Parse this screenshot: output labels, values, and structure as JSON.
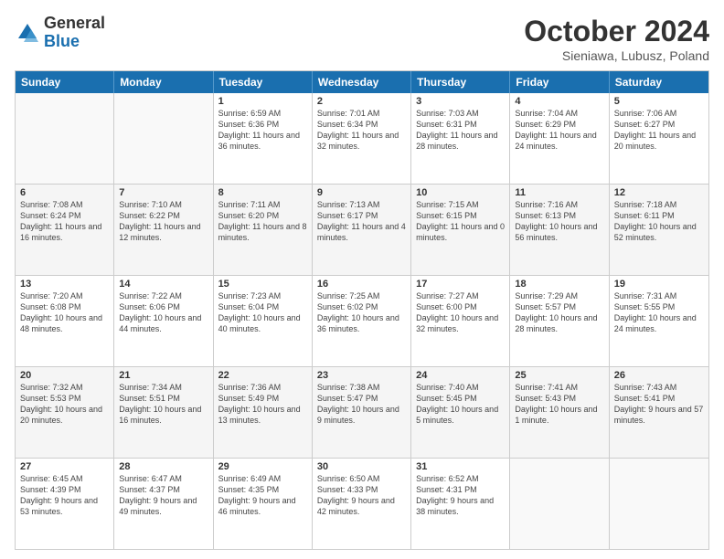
{
  "logo": {
    "general": "General",
    "blue": "Blue"
  },
  "title": "October 2024",
  "subtitle": "Sieniawa, Lubusz, Poland",
  "header_days": [
    "Sunday",
    "Monday",
    "Tuesday",
    "Wednesday",
    "Thursday",
    "Friday",
    "Saturday"
  ],
  "rows": [
    [
      {
        "day": "",
        "text": "",
        "empty": true
      },
      {
        "day": "",
        "text": "",
        "empty": true
      },
      {
        "day": "1",
        "text": "Sunrise: 6:59 AM\nSunset: 6:36 PM\nDaylight: 11 hours and 36 minutes."
      },
      {
        "day": "2",
        "text": "Sunrise: 7:01 AM\nSunset: 6:34 PM\nDaylight: 11 hours and 32 minutes."
      },
      {
        "day": "3",
        "text": "Sunrise: 7:03 AM\nSunset: 6:31 PM\nDaylight: 11 hours and 28 minutes."
      },
      {
        "day": "4",
        "text": "Sunrise: 7:04 AM\nSunset: 6:29 PM\nDaylight: 11 hours and 24 minutes."
      },
      {
        "day": "5",
        "text": "Sunrise: 7:06 AM\nSunset: 6:27 PM\nDaylight: 11 hours and 20 minutes."
      }
    ],
    [
      {
        "day": "6",
        "text": "Sunrise: 7:08 AM\nSunset: 6:24 PM\nDaylight: 11 hours and 16 minutes."
      },
      {
        "day": "7",
        "text": "Sunrise: 7:10 AM\nSunset: 6:22 PM\nDaylight: 11 hours and 12 minutes."
      },
      {
        "day": "8",
        "text": "Sunrise: 7:11 AM\nSunset: 6:20 PM\nDaylight: 11 hours and 8 minutes."
      },
      {
        "day": "9",
        "text": "Sunrise: 7:13 AM\nSunset: 6:17 PM\nDaylight: 11 hours and 4 minutes."
      },
      {
        "day": "10",
        "text": "Sunrise: 7:15 AM\nSunset: 6:15 PM\nDaylight: 11 hours and 0 minutes."
      },
      {
        "day": "11",
        "text": "Sunrise: 7:16 AM\nSunset: 6:13 PM\nDaylight: 10 hours and 56 minutes."
      },
      {
        "day": "12",
        "text": "Sunrise: 7:18 AM\nSunset: 6:11 PM\nDaylight: 10 hours and 52 minutes."
      }
    ],
    [
      {
        "day": "13",
        "text": "Sunrise: 7:20 AM\nSunset: 6:08 PM\nDaylight: 10 hours and 48 minutes."
      },
      {
        "day": "14",
        "text": "Sunrise: 7:22 AM\nSunset: 6:06 PM\nDaylight: 10 hours and 44 minutes."
      },
      {
        "day": "15",
        "text": "Sunrise: 7:23 AM\nSunset: 6:04 PM\nDaylight: 10 hours and 40 minutes."
      },
      {
        "day": "16",
        "text": "Sunrise: 7:25 AM\nSunset: 6:02 PM\nDaylight: 10 hours and 36 minutes."
      },
      {
        "day": "17",
        "text": "Sunrise: 7:27 AM\nSunset: 6:00 PM\nDaylight: 10 hours and 32 minutes."
      },
      {
        "day": "18",
        "text": "Sunrise: 7:29 AM\nSunset: 5:57 PM\nDaylight: 10 hours and 28 minutes."
      },
      {
        "day": "19",
        "text": "Sunrise: 7:31 AM\nSunset: 5:55 PM\nDaylight: 10 hours and 24 minutes."
      }
    ],
    [
      {
        "day": "20",
        "text": "Sunrise: 7:32 AM\nSunset: 5:53 PM\nDaylight: 10 hours and 20 minutes."
      },
      {
        "day": "21",
        "text": "Sunrise: 7:34 AM\nSunset: 5:51 PM\nDaylight: 10 hours and 16 minutes."
      },
      {
        "day": "22",
        "text": "Sunrise: 7:36 AM\nSunset: 5:49 PM\nDaylight: 10 hours and 13 minutes."
      },
      {
        "day": "23",
        "text": "Sunrise: 7:38 AM\nSunset: 5:47 PM\nDaylight: 10 hours and 9 minutes."
      },
      {
        "day": "24",
        "text": "Sunrise: 7:40 AM\nSunset: 5:45 PM\nDaylight: 10 hours and 5 minutes."
      },
      {
        "day": "25",
        "text": "Sunrise: 7:41 AM\nSunset: 5:43 PM\nDaylight: 10 hours and 1 minute."
      },
      {
        "day": "26",
        "text": "Sunrise: 7:43 AM\nSunset: 5:41 PM\nDaylight: 9 hours and 57 minutes."
      }
    ],
    [
      {
        "day": "27",
        "text": "Sunrise: 6:45 AM\nSunset: 4:39 PM\nDaylight: 9 hours and 53 minutes."
      },
      {
        "day": "28",
        "text": "Sunrise: 6:47 AM\nSunset: 4:37 PM\nDaylight: 9 hours and 49 minutes."
      },
      {
        "day": "29",
        "text": "Sunrise: 6:49 AM\nSunset: 4:35 PM\nDaylight: 9 hours and 46 minutes."
      },
      {
        "day": "30",
        "text": "Sunrise: 6:50 AM\nSunset: 4:33 PM\nDaylight: 9 hours and 42 minutes."
      },
      {
        "day": "31",
        "text": "Sunrise: 6:52 AM\nSunset: 4:31 PM\nDaylight: 9 hours and 38 minutes."
      },
      {
        "day": "",
        "text": "",
        "empty": true
      },
      {
        "day": "",
        "text": "",
        "empty": true
      }
    ]
  ]
}
